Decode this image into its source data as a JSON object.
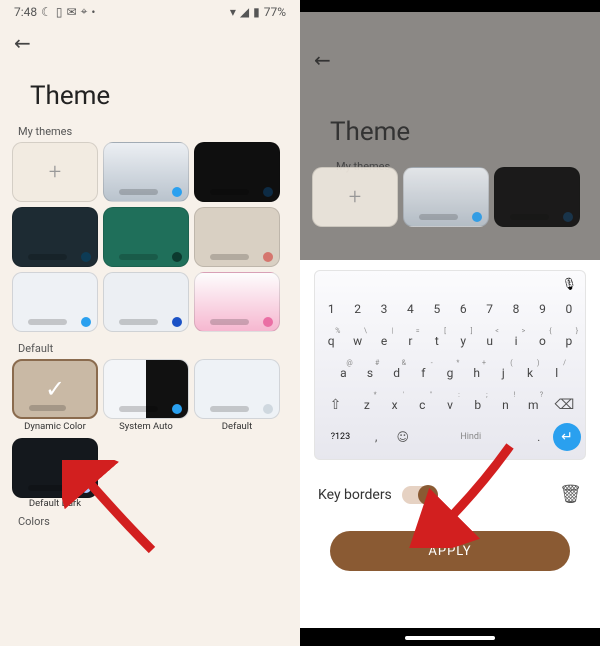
{
  "left": {
    "status": {
      "time": "7:48",
      "icons_left": [
        "moon",
        "battery-small",
        "mail",
        "pin",
        "dot"
      ],
      "icons_right": [
        "wifi",
        "signal",
        "battery"
      ],
      "battery_pct": "77%"
    },
    "title": "Theme",
    "sections": {
      "my_themes_label": "My themes",
      "default_label": "Default",
      "colors_label": "Colors"
    },
    "my_themes": [
      {
        "kind": "add"
      },
      {
        "bg_top": "#eceff3",
        "bg_bot": "#b9c3cd",
        "gradient": true,
        "dot": "#2aa0ef"
      },
      {
        "bg": "#0f0f0f",
        "dot": "#0d2b44"
      },
      {
        "bg": "#1d2b33",
        "dot": "#0d3b55"
      },
      {
        "bg": "#1f6f5a",
        "dot": "#0c3a2f"
      },
      {
        "bg": "#d9d0c3",
        "dot": "#d5766e"
      },
      {
        "bg": "#eef1f5",
        "dot": "#2aa0ef"
      },
      {
        "bg": "#eceff3",
        "dot": "#1b52c6"
      },
      {
        "bg_top": "#fdfdfd",
        "bg_bot": "#f6b7d0",
        "gradient": true,
        "dot": "#ea6fa4"
      }
    ],
    "default_themes": [
      {
        "name": "Dynamic Color",
        "bg": "#c9b9a5",
        "selected": true
      },
      {
        "name": "System Auto",
        "split": true,
        "bg": "#f3f5f8",
        "dot": "#2aa0ef"
      },
      {
        "name": "Default",
        "bg": "#eef2f6",
        "dot": "#cfd8df"
      },
      {
        "name": "Default Dark",
        "bg": "#14181d",
        "dot": "#a9c8ff"
      }
    ]
  },
  "right": {
    "title": "Theme",
    "preview_themes": [
      {
        "kind": "add"
      },
      {
        "bg_top": "#eceff3",
        "bg_bot": "#b9c3cd",
        "gradient": true,
        "dot": "#2aa0ef"
      },
      {
        "bg": "#0f0f0f",
        "dot": "#0d2b44"
      }
    ],
    "keyboard": {
      "row_num": [
        "1",
        "2",
        "3",
        "4",
        "5",
        "6",
        "7",
        "8",
        "9",
        "0"
      ],
      "row1": [
        {
          "k": "q",
          "s": "%"
        },
        {
          "k": "w",
          "s": "\\"
        },
        {
          "k": "e",
          "s": "|"
        },
        {
          "k": "r",
          "s": "="
        },
        {
          "k": "t",
          "s": "["
        },
        {
          "k": "y",
          "s": "]"
        },
        {
          "k": "u",
          "s": "<"
        },
        {
          "k": "i",
          "s": ">"
        },
        {
          "k": "o",
          "s": "{"
        },
        {
          "k": "p",
          "s": "}"
        }
      ],
      "row2": [
        {
          "k": "a",
          "s": "@"
        },
        {
          "k": "s",
          "s": "#"
        },
        {
          "k": "d",
          "s": "&"
        },
        {
          "k": "f",
          "s": "-"
        },
        {
          "k": "g",
          "s": "*"
        },
        {
          "k": "h",
          "s": "+"
        },
        {
          "k": "j",
          "s": "("
        },
        {
          "k": "k",
          "s": ")"
        },
        {
          "k": "l",
          "s": "/"
        }
      ],
      "row3": [
        {
          "k": "z",
          "s": "*"
        },
        {
          "k": "x",
          "s": "'"
        },
        {
          "k": "c",
          "s": "\""
        },
        {
          "k": "v",
          "s": ":"
        },
        {
          "k": "b",
          "s": ";"
        },
        {
          "k": "n",
          "s": "!"
        },
        {
          "k": "m",
          "s": "?"
        }
      ],
      "sym_label": "?123",
      "space_label": "Hindi",
      "enter_glyph": "←"
    },
    "options": {
      "key_borders_label": "Key borders",
      "key_borders_on": true
    },
    "apply_label": "APPLY"
  }
}
